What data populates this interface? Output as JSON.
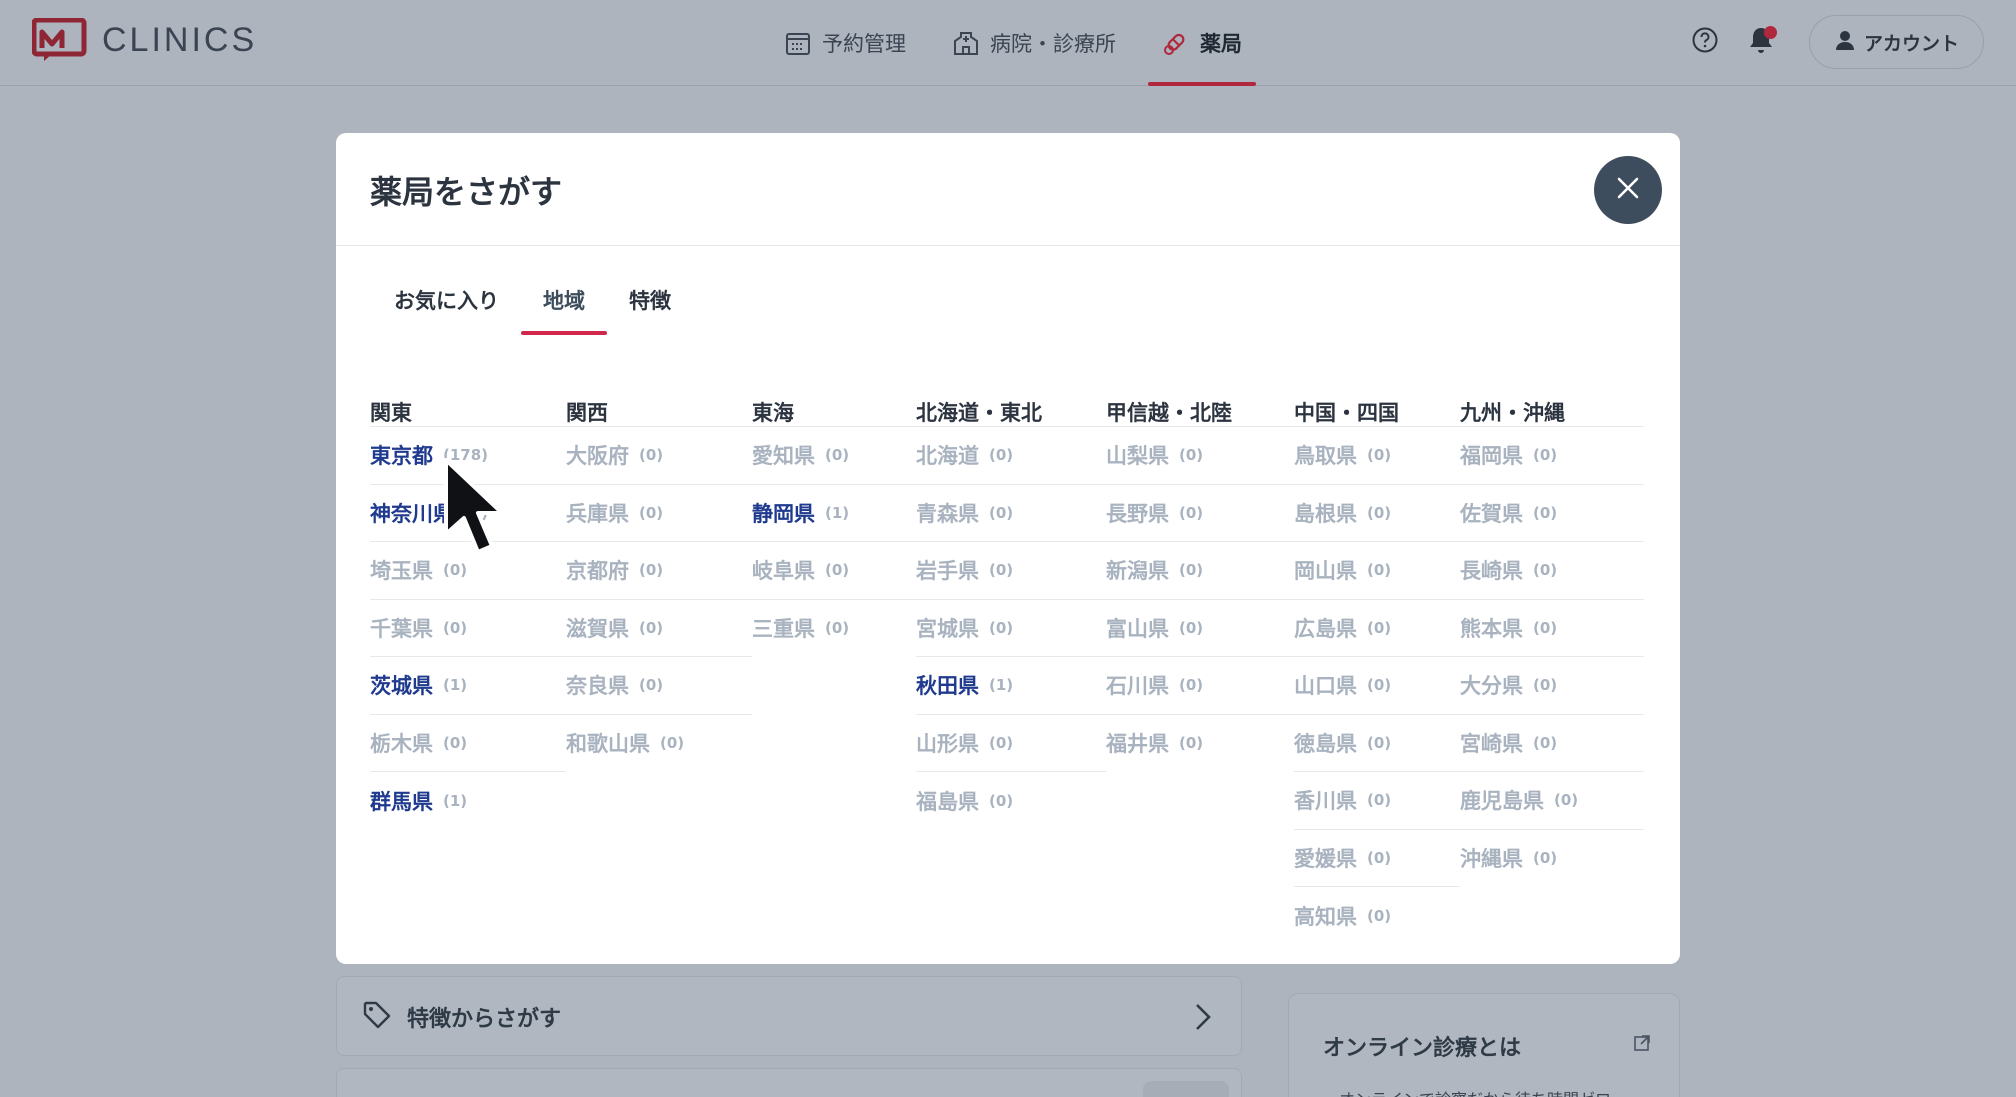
{
  "header": {
    "logo_text": "CLINICS",
    "nav": [
      {
        "label": "予約管理",
        "icon": "calendar-icon",
        "active": false
      },
      {
        "label": "病院・診療所",
        "icon": "hospital-icon",
        "active": false
      },
      {
        "label": "薬局",
        "icon": "pill-icon",
        "active": true
      }
    ],
    "account_label": "アカウント"
  },
  "background": {
    "feature_search_label": "特徴からさがす",
    "online_title": "オンライン診療とは",
    "online_text": "・オンラインで診察だから待ち時間ゼロ"
  },
  "modal": {
    "title": "薬局をさがす",
    "tabs": [
      {
        "label": "お気に入り",
        "active": false
      },
      {
        "label": "地域",
        "active": true
      },
      {
        "label": "特徴",
        "active": false
      }
    ],
    "regions": [
      {
        "name": "関東",
        "prefs": [
          {
            "name": "東京都",
            "count": "(178)",
            "on": true
          },
          {
            "name": "神奈川県",
            "count": "(2)",
            "on": true
          },
          {
            "name": "埼玉県",
            "count": "(0)",
            "on": false
          },
          {
            "name": "千葉県",
            "count": "(0)",
            "on": false
          },
          {
            "name": "茨城県",
            "count": "(1)",
            "on": true
          },
          {
            "name": "栃木県",
            "count": "(0)",
            "on": false
          },
          {
            "name": "群馬県",
            "count": "(1)",
            "on": true
          }
        ]
      },
      {
        "name": "関西",
        "prefs": [
          {
            "name": "大阪府",
            "count": "(0)",
            "on": false
          },
          {
            "name": "兵庫県",
            "count": "(0)",
            "on": false
          },
          {
            "name": "京都府",
            "count": "(0)",
            "on": false
          },
          {
            "name": "滋賀県",
            "count": "(0)",
            "on": false
          },
          {
            "name": "奈良県",
            "count": "(0)",
            "on": false
          },
          {
            "name": "和歌山県",
            "count": "(0)",
            "on": false
          }
        ]
      },
      {
        "name": "東海",
        "prefs": [
          {
            "name": "愛知県",
            "count": "(0)",
            "on": false
          },
          {
            "name": "静岡県",
            "count": "(1)",
            "on": true
          },
          {
            "name": "岐阜県",
            "count": "(0)",
            "on": false
          },
          {
            "name": "三重県",
            "count": "(0)",
            "on": false
          }
        ]
      },
      {
        "name": "北海道・東北",
        "prefs": [
          {
            "name": "北海道",
            "count": "(0)",
            "on": false
          },
          {
            "name": "青森県",
            "count": "(0)",
            "on": false
          },
          {
            "name": "岩手県",
            "count": "(0)",
            "on": false
          },
          {
            "name": "宮城県",
            "count": "(0)",
            "on": false
          },
          {
            "name": "秋田県",
            "count": "(1)",
            "on": true
          },
          {
            "name": "山形県",
            "count": "(0)",
            "on": false
          },
          {
            "name": "福島県",
            "count": "(0)",
            "on": false
          }
        ]
      },
      {
        "name": "甲信越・北陸",
        "prefs": [
          {
            "name": "山梨県",
            "count": "(0)",
            "on": false
          },
          {
            "name": "長野県",
            "count": "(0)",
            "on": false
          },
          {
            "name": "新潟県",
            "count": "(0)",
            "on": false
          },
          {
            "name": "富山県",
            "count": "(0)",
            "on": false
          },
          {
            "name": "石川県",
            "count": "(0)",
            "on": false
          },
          {
            "name": "福井県",
            "count": "(0)",
            "on": false
          }
        ]
      },
      {
        "name": "中国・四国",
        "prefs": [
          {
            "name": "鳥取県",
            "count": "(0)",
            "on": false
          },
          {
            "name": "島根県",
            "count": "(0)",
            "on": false
          },
          {
            "name": "岡山県",
            "count": "(0)",
            "on": false
          },
          {
            "name": "広島県",
            "count": "(0)",
            "on": false
          },
          {
            "name": "山口県",
            "count": "(0)",
            "on": false
          },
          {
            "name": "徳島県",
            "count": "(0)",
            "on": false
          },
          {
            "name": "香川県",
            "count": "(0)",
            "on": false
          },
          {
            "name": "愛媛県",
            "count": "(0)",
            "on": false
          },
          {
            "name": "高知県",
            "count": "(0)",
            "on": false
          }
        ]
      },
      {
        "name": "九州・沖縄",
        "prefs": [
          {
            "name": "福岡県",
            "count": "(0)",
            "on": false
          },
          {
            "name": "佐賀県",
            "count": "(0)",
            "on": false
          },
          {
            "name": "長崎県",
            "count": "(0)",
            "on": false
          },
          {
            "name": "熊本県",
            "count": "(0)",
            "on": false
          },
          {
            "name": "大分県",
            "count": "(0)",
            "on": false
          },
          {
            "name": "宮崎県",
            "count": "(0)",
            "on": false
          },
          {
            "name": "鹿児島県",
            "count": "(0)",
            "on": false
          },
          {
            "name": "沖縄県",
            "count": "(0)",
            "on": false
          }
        ]
      }
    ]
  },
  "colors": {
    "accent": "#d0284a",
    "link": "#1f3a8f",
    "muted": "#a9b3c0",
    "close_bg": "#3e4d5e"
  }
}
